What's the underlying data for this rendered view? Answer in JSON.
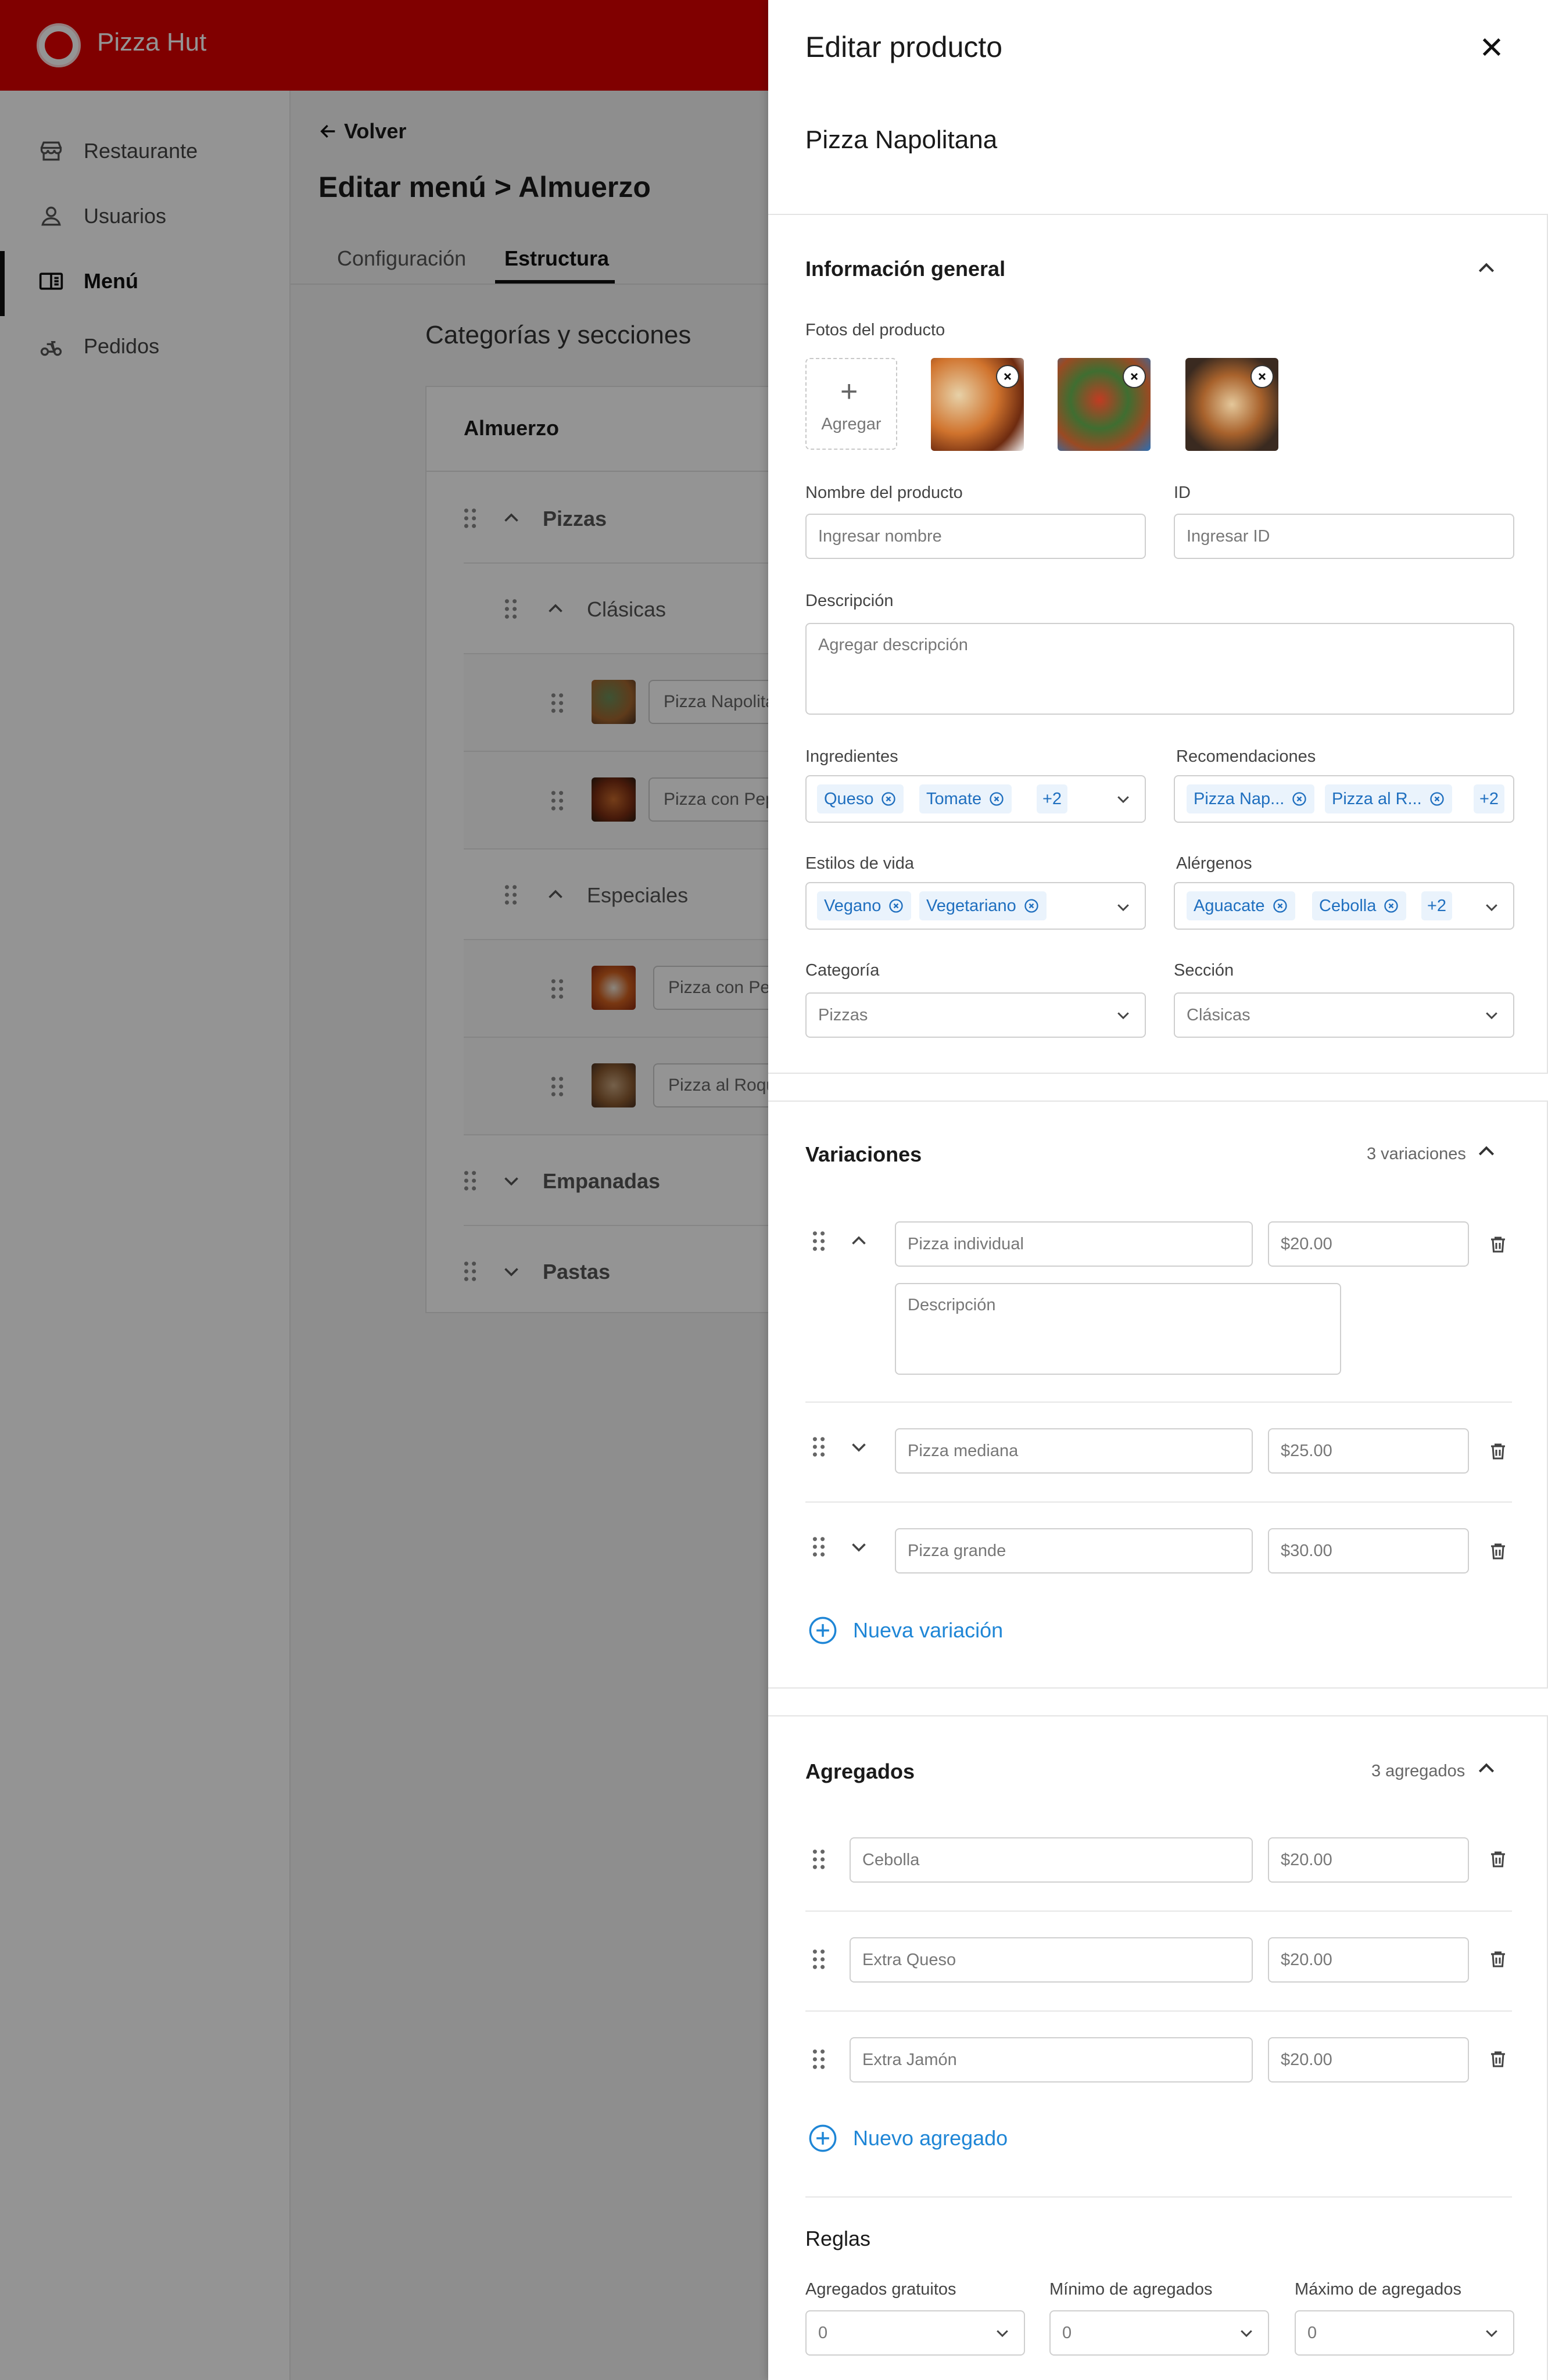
{
  "app": {
    "brand": "Pizza Hut"
  },
  "sidebar": {
    "items": [
      {
        "label": "Restaurante",
        "icon": "store-icon"
      },
      {
        "label": "Usuarios",
        "icon": "user-icon"
      },
      {
        "label": "Menú",
        "icon": "menu-book-icon",
        "active": true
      },
      {
        "label": "Pedidos",
        "icon": "delivery-icon"
      }
    ]
  },
  "main": {
    "back_label": "Volver",
    "title": "Editar menú > Almuerzo",
    "tabs": [
      {
        "label": "Configuración"
      },
      {
        "label": "Estructura",
        "active": true
      }
    ],
    "section_title": "Categorías y secciones",
    "structure": {
      "menu_name": "Almuerzo",
      "category_pizzas": "Pizzas",
      "section_clasicas": "Clásicas",
      "product_1": "Pizza  Napolitana",
      "product_2": "Pizza con Pepperoni",
      "section_especiales": "Especiales",
      "product_3": "Pizza con Pepperoni",
      "product_4": "Pizza al Roquefort",
      "category_empanadas": "Empanadas",
      "category_pastas": "Pastas"
    }
  },
  "panel": {
    "title": "Editar producto",
    "product_name": "Pizza Napolitana",
    "general": {
      "title": "Información general",
      "photos_label": "Fotos del producto",
      "add_photo": "Agregar",
      "name_label": "Nombre del producto",
      "name_placeholder": "Ingresar nombre",
      "id_label": "ID",
      "id_placeholder": "Ingresar ID",
      "desc_label": "Descripción",
      "desc_placeholder": "Agregar descripción",
      "ingredients_label": "Ingredientes",
      "ingredients": [
        "Queso",
        "Tomate"
      ],
      "ingredients_more": "+2",
      "recommendations_label": "Recomendaciones",
      "recommendations": [
        "Pizza Nap...",
        "Pizza al R..."
      ],
      "recommendations_more": "+2",
      "lifestyle_label": "Estilos de vida",
      "lifestyles": [
        "Vegano",
        "Vegetariano"
      ],
      "allergens_label": "Alérgenos",
      "allergens": [
        "Aguacate",
        "Cebolla"
      ],
      "allergens_more": "+2",
      "category_label": "Categoría",
      "category_value": "Pizzas",
      "section_label": "Sección",
      "section_value": "Clásicas"
    },
    "variations": {
      "title": "Variaciones",
      "count": "3 variaciones",
      "items": [
        {
          "name": "Pizza individual",
          "price": "$20.00",
          "desc_placeholder": "Descripción"
        },
        {
          "name": "Pizza mediana",
          "price": "$25.00"
        },
        {
          "name": "Pizza grande",
          "price": "$30.00"
        }
      ],
      "new_label": "Nueva variación"
    },
    "addons": {
      "title": "Agregados",
      "count": "3 agregados",
      "items": [
        {
          "name": "Cebolla",
          "price": "$20.00"
        },
        {
          "name": "Extra Queso",
          "price": "$20.00"
        },
        {
          "name": "Extra Jamón",
          "price": "$20.00"
        }
      ],
      "new_label": "Nuevo agregado"
    },
    "rules": {
      "title": "Reglas",
      "free_label": "Agregados gratuitos",
      "free_value": "0",
      "min_label": "Mínimo de agregados",
      "min_value": "0",
      "max_label": "Máximo de agregados",
      "max_value": "0"
    }
  },
  "colors": {
    "brand_red": "#dc0000",
    "accent_blue": "#1f86d6",
    "chip_bg": "#eaf3fc",
    "chip_text": "#1f6fbf"
  }
}
